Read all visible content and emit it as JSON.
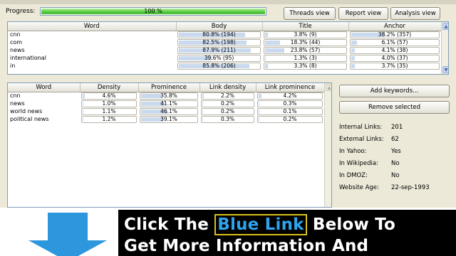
{
  "progress": {
    "label": "Progress:",
    "text": "100 %",
    "fraction": 1.0
  },
  "views": {
    "threads": "Threads view",
    "report": "Report view",
    "analysis": "Analysis view"
  },
  "keyword_table": {
    "headers": [
      "Word",
      "Body",
      "Title",
      "Anchor"
    ],
    "rows": [
      {
        "word": "cnn",
        "body": "80.8% (194)",
        "body_frac": 0.808,
        "title": "3.8% (9)",
        "title_frac": 0.038,
        "anchor": "38.2% (357)",
        "anchor_frac": 0.382
      },
      {
        "word": "com",
        "body": "82.5% (198)",
        "body_frac": 0.825,
        "title": "18.3% (44)",
        "title_frac": 0.183,
        "anchor": "6.1% (57)",
        "anchor_frac": 0.061
      },
      {
        "word": "news",
        "body": "87.9% (211)",
        "body_frac": 0.879,
        "title": "23.8% (57)",
        "title_frac": 0.238,
        "anchor": "4.1% (38)",
        "anchor_frac": 0.041
      },
      {
        "word": "international",
        "body": "39.6% (95)",
        "body_frac": 0.396,
        "title": "1.3% (3)",
        "title_frac": 0.013,
        "anchor": "4.0% (37)",
        "anchor_frac": 0.04
      },
      {
        "word": "in",
        "body": "85.8% (206)",
        "body_frac": 0.858,
        "title": "3.3% (8)",
        "title_frac": 0.033,
        "anchor": "3.7% (35)",
        "anchor_frac": 0.037
      }
    ]
  },
  "density_table": {
    "headers": [
      "Word",
      "Density",
      "Prominence",
      "Link density",
      "Link prominence"
    ],
    "rows": [
      {
        "word": "cnn",
        "density": "4.6%",
        "density_frac": 0.046,
        "prominence": "35.8%",
        "prominence_frac": 0.358,
        "link_density": "2.2%",
        "link_density_frac": 0.022,
        "link_prominence": "4.2%",
        "link_prominence_frac": 0.042
      },
      {
        "word": "news",
        "density": "1.0%",
        "density_frac": 0.01,
        "prominence": "41.1%",
        "prominence_frac": 0.411,
        "link_density": "0.2%",
        "link_density_frac": 0.002,
        "link_prominence": "0.3%",
        "link_prominence_frac": 0.003
      },
      {
        "word": "world news",
        "density": "1.1%",
        "density_frac": 0.011,
        "prominence": "46.1%",
        "prominence_frac": 0.461,
        "link_density": "0.2%",
        "link_density_frac": 0.002,
        "link_prominence": "0.1%",
        "link_prominence_frac": 0.001
      },
      {
        "word": "political news",
        "density": "1.2%",
        "density_frac": 0.012,
        "prominence": "39.1%",
        "prominence_frac": 0.391,
        "link_density": "0.3%",
        "link_density_frac": 0.003,
        "link_prominence": "0.2%",
        "link_prominence_frac": 0.002
      }
    ]
  },
  "side_buttons": {
    "add": "Add keywords...",
    "remove": "Remove selected"
  },
  "stats": [
    {
      "label": "Internal Links:",
      "value": "201"
    },
    {
      "label": "External Links:",
      "value": "62"
    },
    {
      "label": "In Yahoo:",
      "value": "Yes"
    },
    {
      "label": "In Wikipedia:",
      "value": "No"
    },
    {
      "label": "In DMOZ:",
      "value": "No"
    },
    {
      "label": "Website Age:",
      "value": "22-sep-1993"
    }
  ],
  "banner": {
    "line1_pre": "Click The ",
    "line1_highlight": "Blue Link",
    "line1_post": " Below To",
    "line2": "Get More Information And"
  },
  "colors": {
    "progress_green": "#40b82a",
    "bar_fill": "#c9d9ee",
    "arrow_blue": "#2c97dd",
    "highlight_blue": "#2ea3ee"
  }
}
